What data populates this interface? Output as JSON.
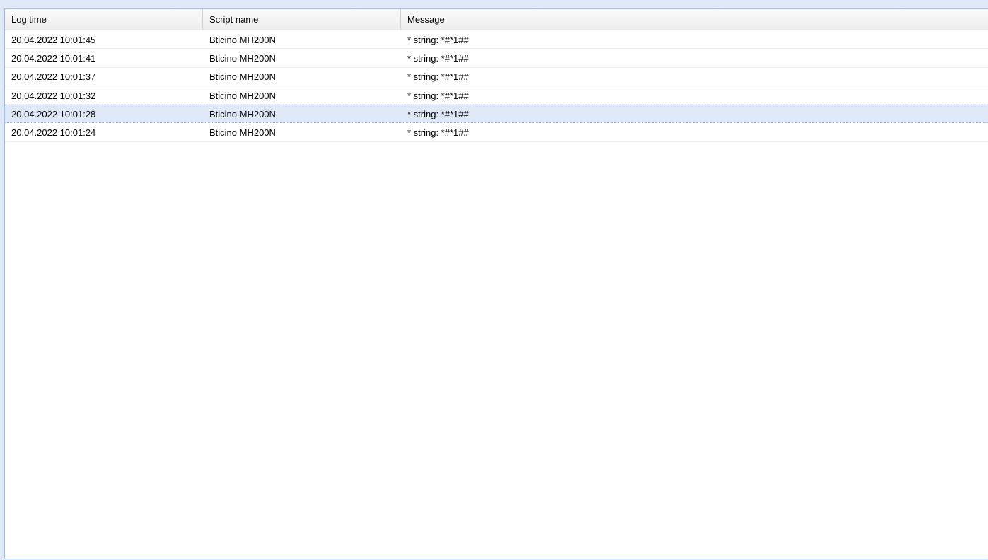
{
  "columns": {
    "log_time": "Log time",
    "script_name": "Script name",
    "message": "Message"
  },
  "rows": [
    {
      "log_time": "20.04.2022 10:01:45",
      "script_name": "Bticino MH200N",
      "message": "* string: *#*1##",
      "selected": false
    },
    {
      "log_time": "20.04.2022 10:01:41",
      "script_name": "Bticino MH200N",
      "message": "* string: *#*1##",
      "selected": false
    },
    {
      "log_time": "20.04.2022 10:01:37",
      "script_name": "Bticino MH200N",
      "message": "* string: *#*1##",
      "selected": false
    },
    {
      "log_time": "20.04.2022 10:01:32",
      "script_name": "Bticino MH200N",
      "message": "* string: *#*1##",
      "selected": false
    },
    {
      "log_time": "20.04.2022 10:01:28",
      "script_name": "Bticino MH200N",
      "message": "* string: *#*1##",
      "selected": true
    },
    {
      "log_time": "20.04.2022 10:01:24",
      "script_name": "Bticino MH200N",
      "message": "* string: *#*1##",
      "selected": false
    }
  ],
  "colors": {
    "background": "#dfe8f6",
    "panel_border": "#99bbe8",
    "selected_row": "#dfe8f6",
    "selected_row_border": "#a3bae9"
  }
}
